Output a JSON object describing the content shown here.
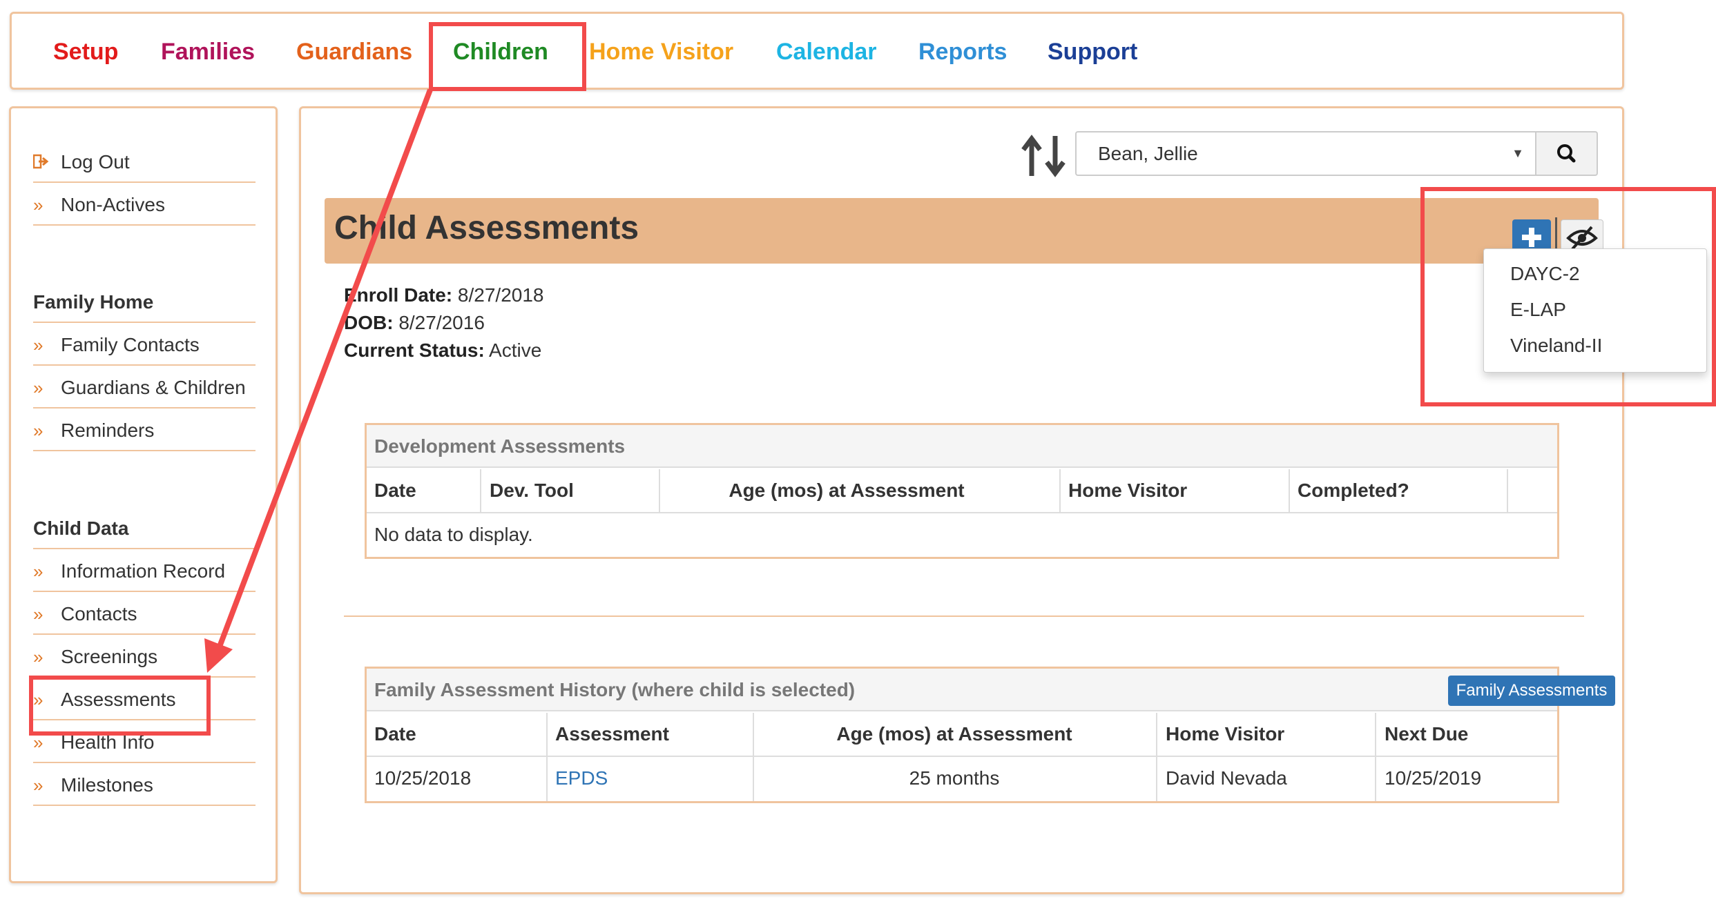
{
  "nav": {
    "items": [
      {
        "label": "Setup",
        "color": "#e21b1b"
      },
      {
        "label": "Families",
        "color": "#b0135a"
      },
      {
        "label": "Guardians",
        "color": "#e3611b"
      },
      {
        "label": "Children",
        "color": "#1f8a24"
      },
      {
        "label": "Home Visitor",
        "color": "#f5a21b"
      },
      {
        "label": "Calendar",
        "color": "#1db4e3"
      },
      {
        "label": "Reports",
        "color": "#2f8fd6"
      },
      {
        "label": "Support",
        "color": "#1b3f96"
      }
    ]
  },
  "sidebar": {
    "top_links": [
      {
        "label": "Log Out",
        "icon": "sign-out-icon"
      },
      {
        "label": "Non-Actives",
        "icon": "double-chevron-right-icon"
      }
    ],
    "family_home": {
      "heading": "Family Home",
      "links": [
        "Family Contacts",
        "Guardians & Children",
        "Reminders"
      ]
    },
    "child_data": {
      "heading": "Child Data",
      "links": [
        "Information Record",
        "Contacts",
        "Screenings",
        "Assessments",
        "Health Info",
        "Milestones"
      ]
    }
  },
  "main": {
    "selected_child": "Bean, Jellie",
    "title": "Child Assessments",
    "info": {
      "enroll_label": "Enroll Date:",
      "enroll_value": "8/27/2018",
      "dob_label": "DOB:",
      "dob_value": "8/27/2016",
      "status_label": "Current Status:",
      "status_value": "Active"
    },
    "add_menu": [
      "DAYC-2",
      "E-LAP",
      "Vineland-II"
    ],
    "dev_assessments": {
      "title": "Development Assessments",
      "columns": [
        "Date",
        "Dev. Tool",
        "Age (mos) at Assessment",
        "Home Visitor",
        "Completed?"
      ],
      "empty_text": "No data to display."
    },
    "family_history": {
      "title": "Family Assessment History (where child is selected)",
      "button": "Family Assessments",
      "columns": [
        "Date",
        "Assessment",
        "Age (mos) at Assessment",
        "Home Visitor",
        "Next Due"
      ],
      "rows": [
        {
          "date": "10/25/2018",
          "assessment": "EPDS",
          "age": "25 months",
          "home_visitor": "David Nevada",
          "next_due": "10/25/2019"
        }
      ]
    }
  },
  "colors": {
    "accent_border": "#f0c49e",
    "header_band": "#e8b68a",
    "primary_button": "#2f74b5",
    "annotation_red": "#f24b4b",
    "link_blue": "#2f74b5"
  }
}
